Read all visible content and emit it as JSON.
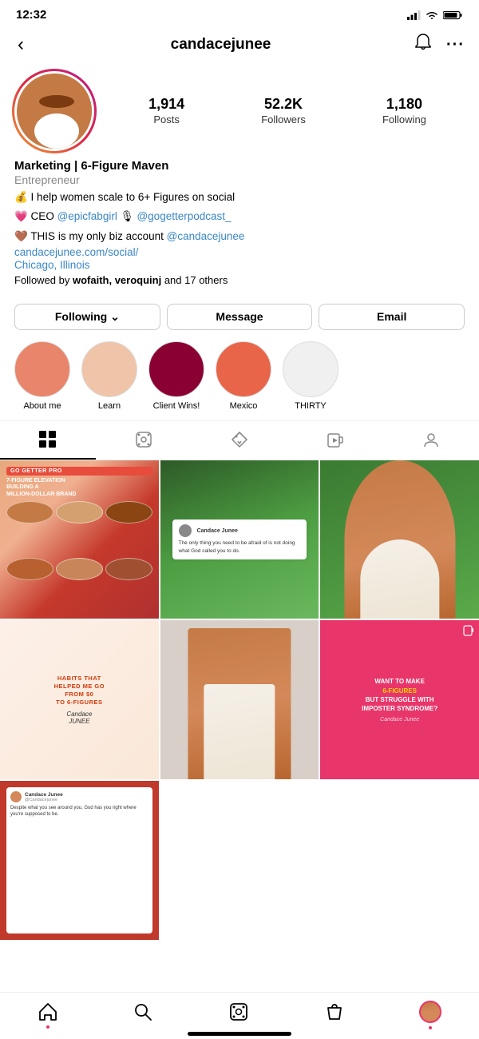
{
  "statusBar": {
    "time": "12:32",
    "navArrow": "›"
  },
  "nav": {
    "backLabel": "‹",
    "username": "candacejunee",
    "notificationIcon": "🔔",
    "moreIcon": "···"
  },
  "profile": {
    "stats": {
      "posts": {
        "value": "1,914",
        "label": "Posts"
      },
      "followers": {
        "value": "52.2K",
        "label": "Followers"
      },
      "following": {
        "value": "1,180",
        "label": "Following"
      }
    },
    "bio": {
      "name": "Marketing | 6-Figure Maven",
      "title": "Entrepreneur",
      "line1": "💰 I help women scale to 6+ Figures on social",
      "line2_pre": "💗 CEO ",
      "mention1": "@epicfabgirl",
      "line2_mid": " 🎙 ",
      "mention2": "@gogetterpodcast_",
      "line3_pre": "🤎 THIS is my only biz account ",
      "mention3": "@candacejunee",
      "link": "candacejunee.com/social/",
      "location": "Chicago, Illinois",
      "followedBy_pre": "Followed by ",
      "followedBy_names": "wofaith, veroquinj",
      "followedBy_post": " and 17 others"
    }
  },
  "actionButtons": {
    "following": "Following ⌄",
    "message": "Message",
    "email": "Email"
  },
  "highlights": [
    {
      "label": "About me",
      "color": "#e8856a"
    },
    {
      "label": "Learn",
      "color": "#f0c4a8"
    },
    {
      "label": "Client Wins!",
      "color": "#8b0033"
    },
    {
      "label": "Mexico",
      "color": "#e8654a"
    },
    {
      "label": "THIRTY",
      "color": "#f0f0f0"
    }
  ],
  "tabs": [
    {
      "icon": "grid",
      "active": true
    },
    {
      "icon": "reels",
      "active": false
    },
    {
      "icon": "tagged",
      "active": false
    },
    {
      "icon": "igtv",
      "active": false
    },
    {
      "icon": "profile",
      "active": false
    }
  ],
  "posts": [
    {
      "id": "post-1",
      "badge": "Go Getter Pro",
      "title": "7-Figure Elevation",
      "subtitle": "Building a Million-Dollar Brand",
      "type": "event"
    },
    {
      "id": "post-2",
      "quote": "The only thing you need to be afraid of is not doing what God called you to do.",
      "type": "quote"
    },
    {
      "id": "post-3",
      "type": "photo"
    },
    {
      "id": "post-4",
      "text": "HABITS THAT HELPED ME GO FROM $0 TO 6-FIGURES",
      "sig": "Candace JUNEE",
      "type": "text"
    },
    {
      "id": "post-5",
      "type": "photo"
    },
    {
      "id": "post-6",
      "headline1": "WANT TO MAKE",
      "headline2": "6-FIGURES",
      "headline3": "BUT STRUGGLE WITH",
      "headline4": "IMPOSTER SYNDROME?",
      "sig": "Candace Junee",
      "type": "reel-text"
    },
    {
      "id": "post-7",
      "quote": "Despite what you see around you, God has you right where you're supposed to be.",
      "handle": "@Candacejunee",
      "type": "quote-dark"
    }
  ],
  "bottomNav": {
    "home": "🏠",
    "search": "🔍",
    "reels": "▶",
    "shop": "🛍",
    "profile": "avatar"
  }
}
